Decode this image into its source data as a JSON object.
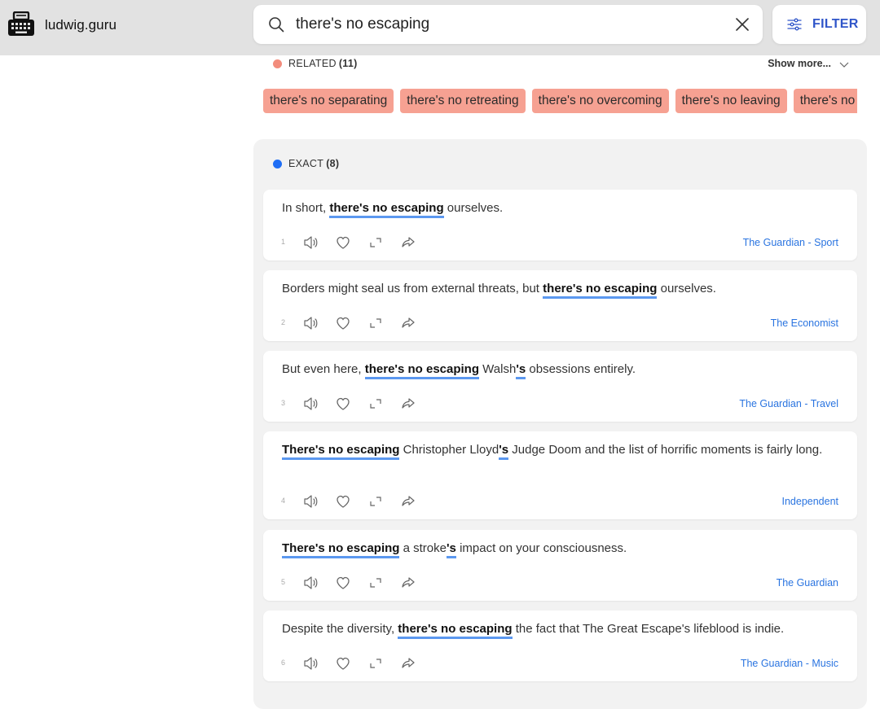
{
  "brand": {
    "name": "ludwig.guru"
  },
  "search": {
    "value": "there's no escaping"
  },
  "filter": {
    "label": "FILTER"
  },
  "related": {
    "label": "RELATED",
    "count": "(11)",
    "show_more": "Show more...",
    "chips": [
      "there's no separating",
      "there's no retreating",
      "there's no overcoming",
      "there's no leaving",
      "there's no"
    ]
  },
  "exact": {
    "label": "EXACT",
    "count": "(8)",
    "results": [
      {
        "num": "1",
        "source": "The Guardian - Sport",
        "parts": [
          {
            "t": "In short, "
          },
          {
            "t": "there's no escaping",
            "b": true
          },
          {
            "t": " ourselves."
          }
        ]
      },
      {
        "num": "2",
        "source": "The Economist",
        "parts": [
          {
            "t": "Borders might seal us from external threats, but "
          },
          {
            "t": "there's no escaping",
            "b": true
          },
          {
            "t": " ourselves."
          }
        ]
      },
      {
        "num": "3",
        "source": "The Guardian - Travel",
        "parts": [
          {
            "t": "But even here, "
          },
          {
            "t": "there's no escaping",
            "b": true
          },
          {
            "t": " Walsh"
          },
          {
            "t": "'s",
            "b": true
          },
          {
            "t": " obsessions entirely."
          }
        ]
      },
      {
        "num": "4",
        "source": "Independent",
        "parts": [
          {
            "t": "There's no escaping",
            "b": true
          },
          {
            "t": " Christopher Lloyd"
          },
          {
            "t": "'s",
            "b": true
          },
          {
            "t": " Judge Doom and the list of horrific moments is fairly long."
          }
        ]
      },
      {
        "num": "5",
        "source": "The Guardian",
        "parts": [
          {
            "t": "There's no escaping",
            "b": true
          },
          {
            "t": " a stroke"
          },
          {
            "t": "'s",
            "b": true
          },
          {
            "t": " impact on your consciousness."
          }
        ]
      },
      {
        "num": "6",
        "source": "The Guardian - Music",
        "parts": [
          {
            "t": "Despite the diversity, "
          },
          {
            "t": "there's no escaping",
            "b": true
          },
          {
            "t": " the fact that The Great Escape's lifeblood is indie."
          }
        ]
      }
    ]
  },
  "icons": [
    "typewriter-logo-icon",
    "search-icon",
    "close-icon",
    "filter-sliders-icon",
    "chevron-down-icon",
    "speaker-icon",
    "heart-icon",
    "expand-icon",
    "share-icon"
  ],
  "colors": {
    "related_dot": "#f28c7c",
    "chip_bg": "#f6a192",
    "exact_dot": "#1f6ef5",
    "highlight_underline": "#5b98f0",
    "source_link": "#2a74e0",
    "filter_text": "#2f55c9"
  }
}
